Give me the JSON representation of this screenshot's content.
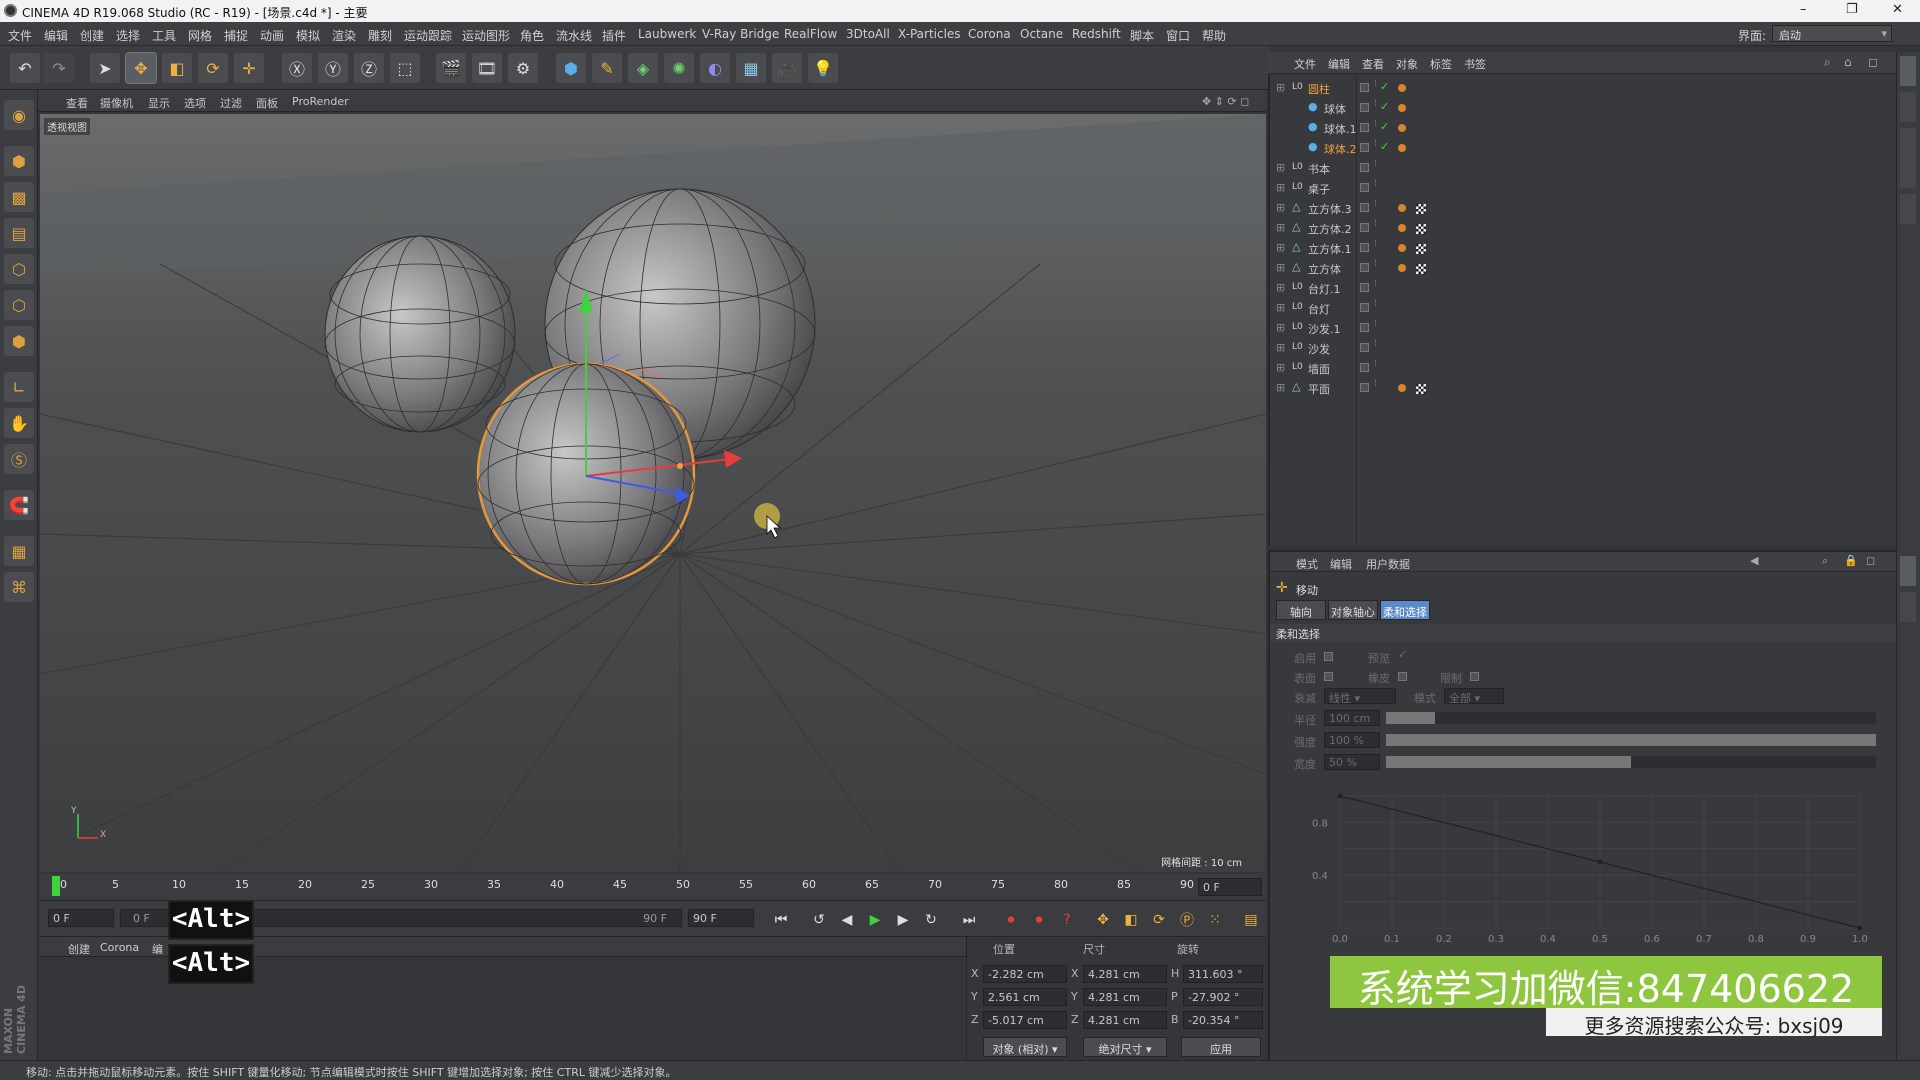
{
  "window": {
    "title": "CINEMA 4D R19.068 Studio (RC - R19) - [场景.c4d *] - 主要",
    "controls": [
      "–",
      "❐",
      "✕"
    ]
  },
  "menubar": {
    "items": [
      "文件",
      "编辑",
      "创建",
      "选择",
      "工具",
      "网格",
      "捕捉",
      "动画",
      "模拟",
      "渲染",
      "雕刻",
      "运动跟踪",
      "运动图形",
      "角色",
      "流水线",
      "插件",
      "Laubwerk",
      "V-Ray Bridge",
      "RealFlow",
      "3DtoAll",
      "X-Particles",
      "Corona",
      "Octane",
      "Redshift",
      "脚本",
      "窗口",
      "帮助"
    ],
    "layout_label": "界面:",
    "layout_value": "启动"
  },
  "viewport": {
    "menu": [
      "查看",
      "摄像机",
      "显示",
      "选项",
      "过滤",
      "面板",
      "ProRender"
    ],
    "label": "透视视图",
    "grid_spacing": "网格间距 : 10 cm",
    "axis_y": "Y",
    "axis_x": "X"
  },
  "timeline": {
    "ticks": [
      "0",
      "5",
      "10",
      "15",
      "20",
      "25",
      "30",
      "35",
      "40",
      "45",
      "50",
      "55",
      "60",
      "65",
      "70",
      "75",
      "80",
      "85",
      "90"
    ],
    "current_frame": "0 F",
    "start_field": "0 F",
    "preview_start": "0 F",
    "preview_end": "90 F",
    "end_field": "90 F"
  },
  "bottom_left": {
    "tabs": [
      "创建",
      "Corona",
      "编"
    ],
    "overlay_keys": [
      "<Alt>",
      "<Alt>"
    ]
  },
  "coords": {
    "headers": [
      "位置",
      "尺寸",
      "旋转"
    ],
    "rows": [
      {
        "axis": "X",
        "pos": "-2.282 cm",
        "size_axis": "X",
        "size": "4.281 cm",
        "rot_axis": "H",
        "rot": "311.603 °"
      },
      {
        "axis": "Y",
        "pos": "2.561 cm",
        "size_axis": "Y",
        "size": "4.281 cm",
        "rot_axis": "P",
        "rot": "-27.902 °"
      },
      {
        "axis": "Z",
        "pos": "-5.017 cm",
        "size_axis": "Z",
        "size": "4.281 cm",
        "rot_axis": "B",
        "rot": "-20.354 °"
      }
    ],
    "mode_select": "对象 (相对)",
    "size_select": "绝对尺寸",
    "apply_button": "应用"
  },
  "statusbar": {
    "text": "移动: 点击并拖动鼠标移动元素。按住 SHIFT 键量化移动; 节点编辑模式时按住 SHIFT 键增加选择对象; 按住 CTRL 键减少选择对象。"
  },
  "object_manager": {
    "menu": [
      "文件",
      "编辑",
      "查看",
      "对象",
      "标签",
      "书签"
    ],
    "objects": [
      {
        "name": "圆柱",
        "indent": 0,
        "type": "null",
        "tags": [
          "orange"
        ],
        "highlight": true
      },
      {
        "name": "球体",
        "indent": 1,
        "type": "sphere",
        "tags": [
          "orange"
        ]
      },
      {
        "name": "球体.1",
        "indent": 1,
        "type": "sphere",
        "tags": [
          "orange"
        ]
      },
      {
        "name": "球体.2",
        "indent": 1,
        "type": "sphere",
        "tags": [
          "orange"
        ],
        "highlight": true
      },
      {
        "name": "书本",
        "indent": 0,
        "type": "null",
        "tags": []
      },
      {
        "name": "桌子",
        "indent": 0,
        "type": "null",
        "tags": []
      },
      {
        "name": "立方体.3",
        "indent": 0,
        "type": "poly",
        "tags": [
          "orange",
          "checker"
        ]
      },
      {
        "name": "立方体.2",
        "indent": 0,
        "type": "poly",
        "tags": [
          "orange",
          "checker"
        ]
      },
      {
        "name": "立方体.1",
        "indent": 0,
        "type": "poly",
        "tags": [
          "orange",
          "checker"
        ]
      },
      {
        "name": "立方体",
        "indent": 0,
        "type": "poly",
        "tags": [
          "orange",
          "checker"
        ]
      },
      {
        "name": "台灯.1",
        "indent": 0,
        "type": "null",
        "tags": []
      },
      {
        "name": "台灯",
        "indent": 0,
        "type": "null",
        "tags": []
      },
      {
        "name": "沙发.1",
        "indent": 0,
        "type": "null",
        "tags": []
      },
      {
        "name": "沙发",
        "indent": 0,
        "type": "null",
        "tags": []
      },
      {
        "name": "墙面",
        "indent": 0,
        "type": "null",
        "tags": []
      },
      {
        "name": "平面",
        "indent": 0,
        "type": "poly",
        "tags": [
          "orange",
          "checker"
        ]
      }
    ]
  },
  "attribute_manager": {
    "menu": [
      "模式",
      "编辑",
      "用户数据"
    ],
    "tool_name": "移动",
    "tabs": [
      "轴向",
      "对象轴心",
      "柔和选择"
    ],
    "active_tab": "柔和选择",
    "section": "柔和选择",
    "fields": {
      "enable": "启用",
      "preview": "预览",
      "surface": "表面",
      "rubber": "橡皮",
      "restrict": "限制",
      "falloff_label": "衰减",
      "falloff_value": "线性",
      "mode_label": "模式",
      "mode_value": "全部",
      "radius_label": "半径",
      "radius_value": "100 cm",
      "strength_label": "强度",
      "strength_value": "100 %",
      "width_label": "宽度",
      "width_value": "50 %"
    },
    "graph": {
      "y_ticks": [
        "0.8",
        "0.4"
      ],
      "x_ticks": [
        "0.0",
        "0.1",
        "0.2",
        "0.3",
        "0.4",
        "0.5",
        "0.6",
        "0.7",
        "0.8",
        "0.9",
        "1.0"
      ],
      "curve": [
        [
          0.0,
          1.0
        ],
        [
          0.5,
          0.5
        ],
        [
          1.0,
          0.0
        ]
      ]
    }
  },
  "watermark": {
    "line1": "系统学习加微信:847406622",
    "line2": "更多资源搜索公众号: bxsj09"
  },
  "left_brand": "MAXON CINEMA 4D",
  "colors": {
    "accent_orange": "#d8842c",
    "selection_orange": "#e8963c",
    "watermark_green": "#8ec63f"
  }
}
